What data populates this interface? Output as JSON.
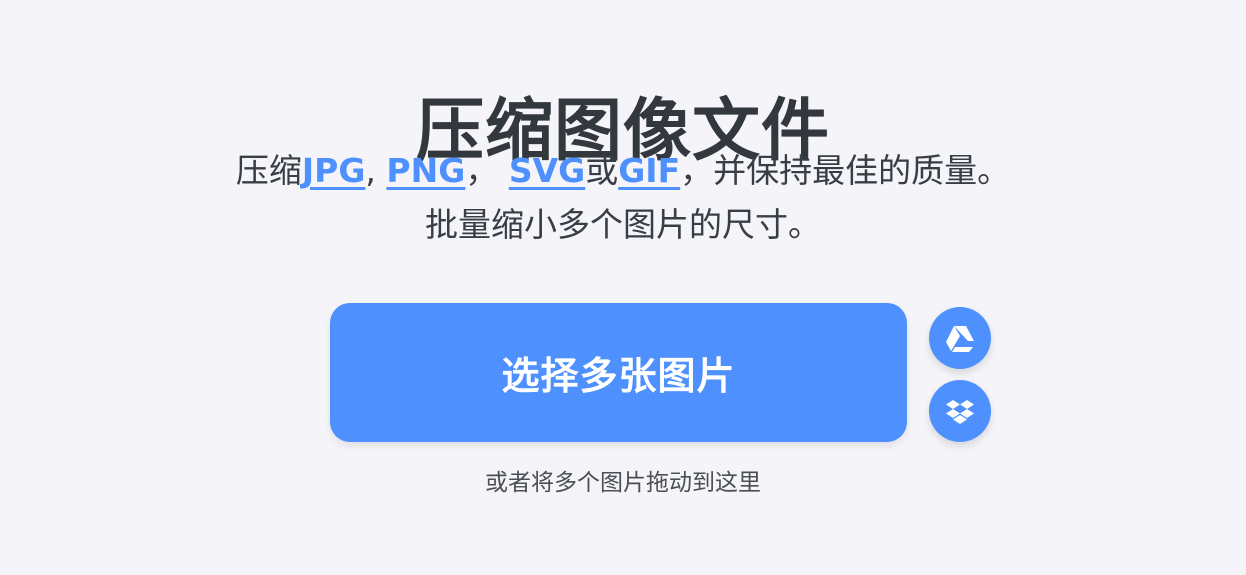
{
  "page": {
    "title": "压缩图像文件",
    "subtitle": {
      "line1_prefix": "压缩",
      "link_jpg": "JPG",
      "sep1": ",",
      "link_png": "PNG",
      "sep2": "，",
      "link_svg": "SVG",
      "or": "或",
      "link_gif": "GIF",
      "line1_suffix": "，并保持最佳的质量。",
      "line2": "批量缩小多个图片的尺寸。"
    }
  },
  "upload": {
    "button_label": "选择多张图片",
    "drop_hint": "或者将多个图片拖动到这里"
  },
  "cloud": {
    "google_drive_icon": "google-drive-icon",
    "dropbox_icon": "dropbox-icon"
  },
  "colors": {
    "accent": "#4d90fe",
    "background": "#f4f4f9",
    "text": "#383e45",
    "button_text": "#ffffff"
  }
}
